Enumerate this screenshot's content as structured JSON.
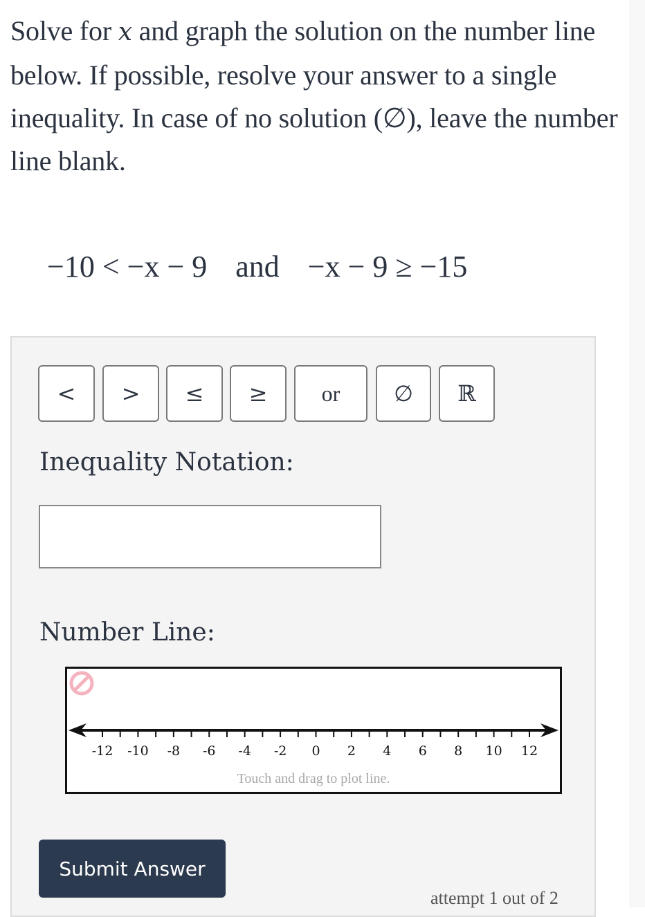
{
  "prompt": {
    "part1": "Solve for ",
    "variable": "x",
    "part2": " and graph the solution on the number line below. If possible, resolve your answer to a single inequality. In case of no solution (∅), leave the number line blank."
  },
  "equation": {
    "left": "−10 < −x − 9",
    "conjunction": "and",
    "right": "−x − 9 ≥ −15"
  },
  "symbol_buttons": [
    {
      "id": "lt",
      "label": "<"
    },
    {
      "id": "gt",
      "label": ">"
    },
    {
      "id": "le",
      "label": "≤"
    },
    {
      "id": "ge",
      "label": "≥"
    },
    {
      "id": "or",
      "label": "or"
    },
    {
      "id": "empty",
      "label": "∅"
    },
    {
      "id": "reals",
      "label": "ℝ"
    }
  ],
  "inequality_notation": {
    "label": "Inequality Notation:",
    "value": ""
  },
  "number_line": {
    "label": "Number Line:",
    "min": -12,
    "max": 12,
    "tick_step": 1,
    "label_step": 2,
    "tick_labels": [
      "-12",
      "-10",
      "-8",
      "-6",
      "-4",
      "-2",
      "0",
      "2",
      "4",
      "6",
      "8",
      "10",
      "12"
    ],
    "hint": "Touch and drag to plot line.",
    "no_solution_icon": "no-solution-icon",
    "no_solution_color": "#f4a7b5"
  },
  "submit_label": "Submit Answer",
  "attempt_text": "attempt 1 out of 2"
}
